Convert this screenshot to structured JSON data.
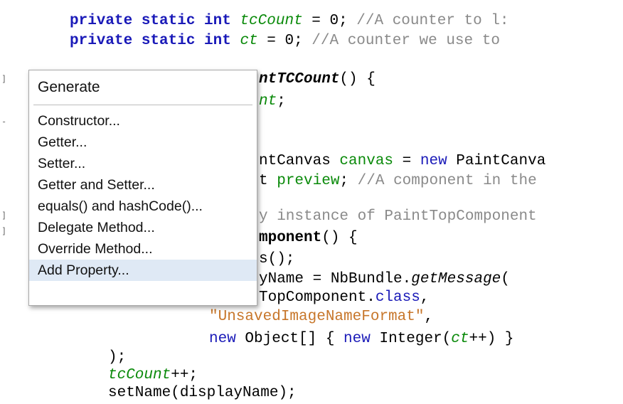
{
  "code_lines": [
    {
      "segments": [
        {
          "t": "private static int ",
          "c": "kw"
        },
        {
          "t": "tcCount",
          "c": "fld"
        },
        {
          "t": " = 0; ",
          "c": ""
        },
        {
          "t": "//A counter to l:",
          "c": "cm"
        }
      ]
    },
    {
      "segments": [
        {
          "t": "private static int ",
          "c": "kw"
        },
        {
          "t": "ct",
          "c": "fld"
        },
        {
          "t": " = 0; ",
          "c": ""
        },
        {
          "t": "//A counter we use to",
          "c": "cm"
        }
      ]
    },
    {
      "segments": [
        {
          "t": "ntTCCount",
          "c": "bi"
        },
        {
          "t": "() {",
          "c": ""
        }
      ]
    },
    {
      "segments": [
        {
          "t": "nt",
          "c": "fld"
        },
        {
          "t": ";",
          "c": ""
        }
      ]
    },
    {
      "segments": [
        {
          "t": "ntCanvas ",
          "c": ""
        },
        {
          "t": "canvas",
          "c": "fldn"
        },
        {
          "t": " = ",
          "c": ""
        },
        {
          "t": "new",
          "c": "kwn"
        },
        {
          "t": " PaintCanva",
          "c": ""
        }
      ]
    },
    {
      "segments": [
        {
          "t": "t ",
          "c": ""
        },
        {
          "t": "preview",
          "c": "fldn"
        },
        {
          "t": "; ",
          "c": ""
        },
        {
          "t": "//A component in the",
          "c": "cm"
        }
      ]
    },
    {
      "segments": [
        {
          "t": "y instance of PaintTopComponent",
          "c": "cm"
        }
      ]
    },
    {
      "segments": [
        {
          "t": "mponent",
          "c": "b"
        },
        {
          "t": "() {",
          "c": ""
        }
      ]
    },
    {
      "segments": [
        {
          "t": "s();",
          "c": ""
        }
      ]
    },
    {
      "segments": [
        {
          "t": "yName = NbBundle.",
          "c": ""
        },
        {
          "t": "getMessage",
          "c": "it"
        },
        {
          "t": "(",
          "c": ""
        }
      ]
    },
    {
      "segments": [
        {
          "t": "TopComponent.",
          "c": ""
        },
        {
          "t": "class",
          "c": "kwn"
        },
        {
          "t": ",",
          "c": ""
        }
      ]
    },
    {
      "segments": [
        {
          "t": "\"UnsavedImageNameFormat\"",
          "c": "str"
        },
        {
          "t": ",",
          "c": ""
        }
      ]
    },
    {
      "segments": [
        {
          "t": "new",
          "c": "kwn"
        },
        {
          "t": " Object[] { ",
          "c": ""
        },
        {
          "t": "new",
          "c": "kwn"
        },
        {
          "t": " Integer(",
          "c": ""
        },
        {
          "t": "ct",
          "c": "fld"
        },
        {
          "t": "++) }",
          "c": ""
        }
      ]
    },
    {
      "segments": [
        {
          "t": ");",
          "c": ""
        }
      ]
    },
    {
      "segments": [
        {
          "t": "tcCount",
          "c": "fld"
        },
        {
          "t": "++;",
          "c": ""
        }
      ]
    },
    {
      "segments": [
        {
          "t": "setName(displayName);",
          "c": ""
        }
      ]
    }
  ],
  "gutter_marks": [
    "]",
    "-",
    "]",
    "]"
  ],
  "menu": {
    "title": "Generate",
    "items": [
      {
        "label": "Constructor..."
      },
      {
        "label": "Getter..."
      },
      {
        "label": "Setter..."
      },
      {
        "label": "Getter and Setter..."
      },
      {
        "label": "equals() and hashCode()..."
      },
      {
        "label": "Delegate Method..."
      },
      {
        "label": "Override Method..."
      },
      {
        "label": "Add Property...",
        "selected": true
      }
    ]
  },
  "colors": {
    "keyword": "#1a1ab8",
    "field": "#0a8a0a",
    "comment": "#8a8a8a",
    "string": "#c7762a",
    "selection": "#dfe9f5"
  }
}
